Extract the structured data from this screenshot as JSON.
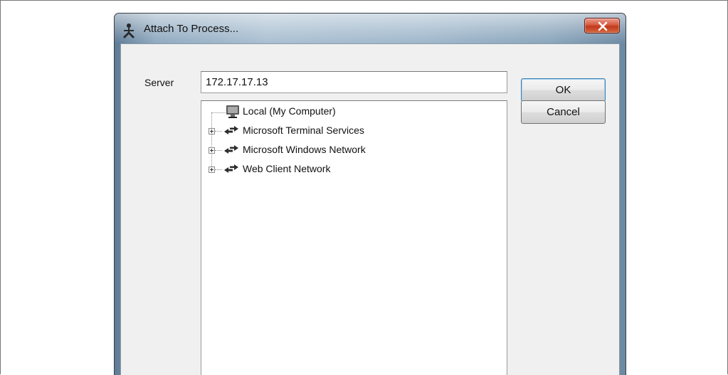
{
  "window": {
    "title": "Attach To Process...",
    "icon": "attach-process-icon",
    "close_icon": "close-icon"
  },
  "server": {
    "label": "Server",
    "value": "172.17.17.13"
  },
  "buttons": {
    "ok_label": "OK",
    "cancel_label": "Cancel"
  },
  "tree": {
    "items": [
      {
        "label": "Local (My Computer)",
        "icon": "computer-icon",
        "expandable": false
      },
      {
        "label": "Microsoft Terminal Services",
        "icon": "network-arrows-icon",
        "expandable": true
      },
      {
        "label": "Microsoft Windows Network",
        "icon": "network-arrows-icon",
        "expandable": true
      },
      {
        "label": "Web Client Network",
        "icon": "network-arrows-icon",
        "expandable": true
      }
    ]
  },
  "colors": {
    "close_button": "#c84a2b",
    "ok_focus_border": "#3c7fb1",
    "dialog_face": "#f0f0f0"
  }
}
